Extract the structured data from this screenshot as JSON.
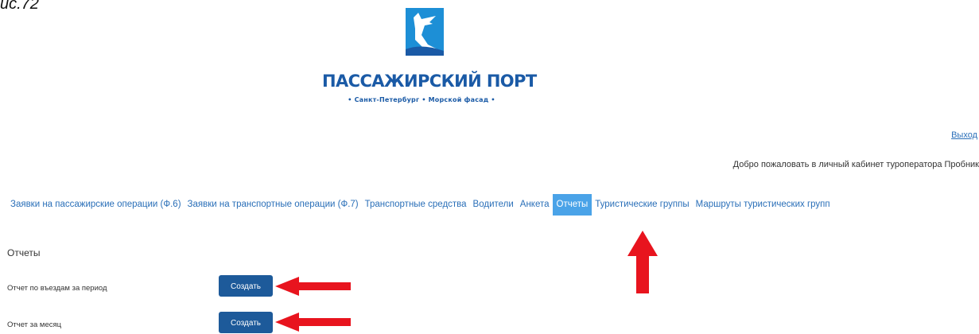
{
  "figure": {
    "caption": "ис.72"
  },
  "logo": {
    "title": "ПАССАЖИРСКИЙ ПОРТ",
    "subtitle": "• Санкт-Петербург • Морской фасад •",
    "color": "#1a5aa6"
  },
  "header": {
    "logout_label": "Выход",
    "welcome_text": "Добро пожаловать в личный кабинет туроператора Пробник"
  },
  "nav": {
    "items": [
      {
        "label": "Заявки на пассажирские операции (Ф.6)",
        "active": false
      },
      {
        "label": "Заявки на транспортные операции (Ф.7)",
        "active": false
      },
      {
        "label": "Транспортные средства",
        "active": false
      },
      {
        "label": "Водители",
        "active": false
      },
      {
        "label": "Анкета",
        "active": false
      },
      {
        "label": "Отчеты",
        "active": true
      },
      {
        "label": "Туристические группы",
        "active": false
      },
      {
        "label": "Маршруты туристических групп",
        "active": false
      }
    ],
    "link_color": "#2a6fb8",
    "active_bg": "#4aa3e8"
  },
  "reports": {
    "section_title": "Отчеты",
    "rows": [
      {
        "label": "Отчет по въездам за период",
        "button_label": "Создать"
      },
      {
        "label": "Отчет за месяц",
        "button_label": "Создать"
      }
    ],
    "button_color": "#1d5a9a"
  },
  "annotations": {
    "arrow_color": "#e8141e"
  }
}
